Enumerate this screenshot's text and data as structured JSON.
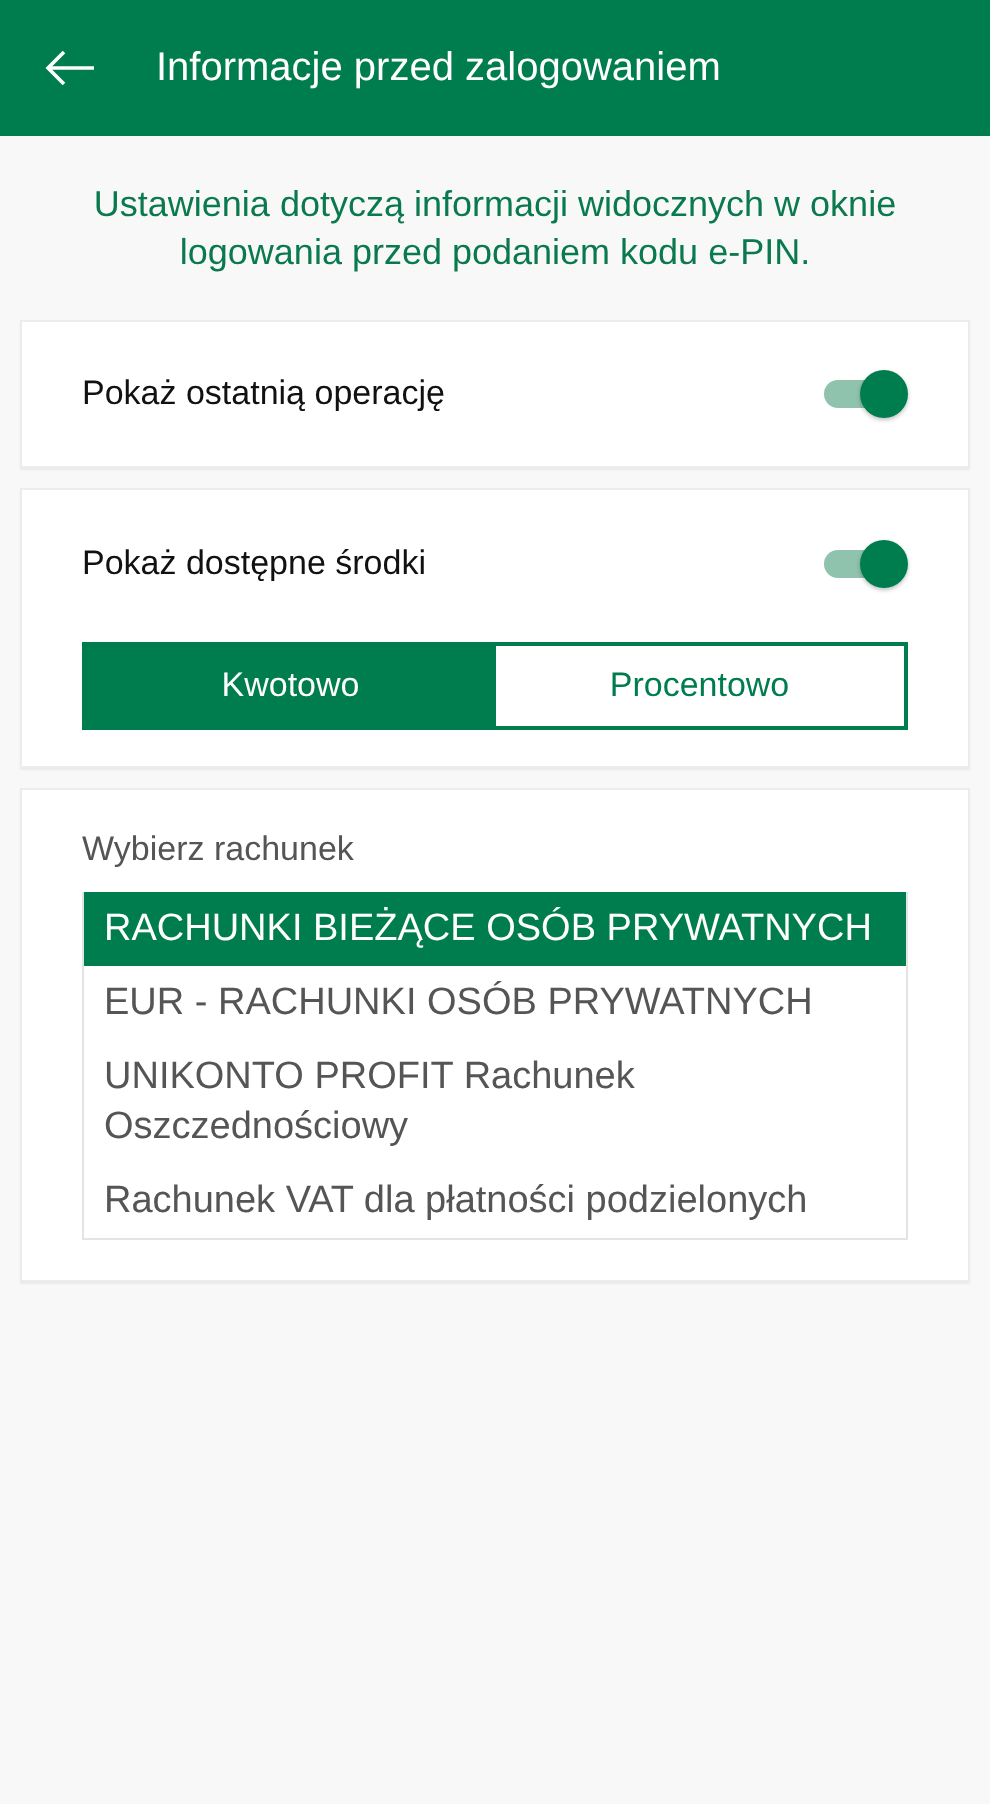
{
  "header": {
    "title": "Informacje przed zalogowaniem"
  },
  "note": "Ustawienia dotyczą informacji widocznych w oknie logowania przed podaniem kodu e-PIN.",
  "settings": [
    {
      "label": "Pokaż ostatnią operację",
      "on": true
    },
    {
      "label": "Pokaż dostępne środki",
      "on": true,
      "segments": [
        {
          "label": "Kwotowo",
          "selected": true
        },
        {
          "label": "Procentowo",
          "selected": false
        }
      ]
    }
  ],
  "account_picker": {
    "label": "Wybierz rachunek",
    "items": [
      {
        "label": "RACHUNKI BIEŻĄCE OSÓB PRYWATNYCH",
        "selected": true
      },
      {
        "label": "EUR - RACHUNKI OSÓB PRYWATNYCH",
        "selected": false
      },
      {
        "label": "UNIKONTO PROFIT Rachunek Oszczednościowy",
        "selected": false
      },
      {
        "label": "Rachunek VAT dla płatności podzielonych",
        "selected": false
      }
    ]
  }
}
